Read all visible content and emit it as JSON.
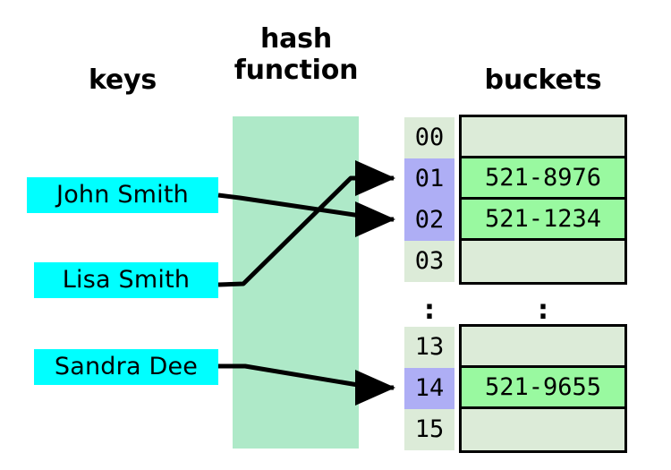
{
  "headings": {
    "keys": "keys",
    "hash_function": "hash\nfunction",
    "buckets": "buckets"
  },
  "colors": {
    "key_box": "#00ffff",
    "hash_band": "#aee9c8",
    "index_empty": "#dcebd8",
    "index_filled": "#aeaef5",
    "bucket_empty": "#dcebd8",
    "bucket_filled": "#99f9a0",
    "stroke": "#000000"
  },
  "keys": [
    {
      "label": "John Smith",
      "maps_to": "02"
    },
    {
      "label": "Lisa Smith",
      "maps_to": "01"
    },
    {
      "label": "Sandra Dee",
      "maps_to": "14"
    }
  ],
  "table": {
    "ellipsis": ":",
    "upper_rows": [
      {
        "index": "00",
        "value": "",
        "filled": false
      },
      {
        "index": "01",
        "value": "521-8976",
        "filled": true
      },
      {
        "index": "02",
        "value": "521-1234",
        "filled": true
      },
      {
        "index": "03",
        "value": "",
        "filled": false
      }
    ],
    "lower_rows": [
      {
        "index": "13",
        "value": "",
        "filled": false
      },
      {
        "index": "14",
        "value": "521-9655",
        "filled": true
      },
      {
        "index": "15",
        "value": "",
        "filled": false
      }
    ]
  }
}
